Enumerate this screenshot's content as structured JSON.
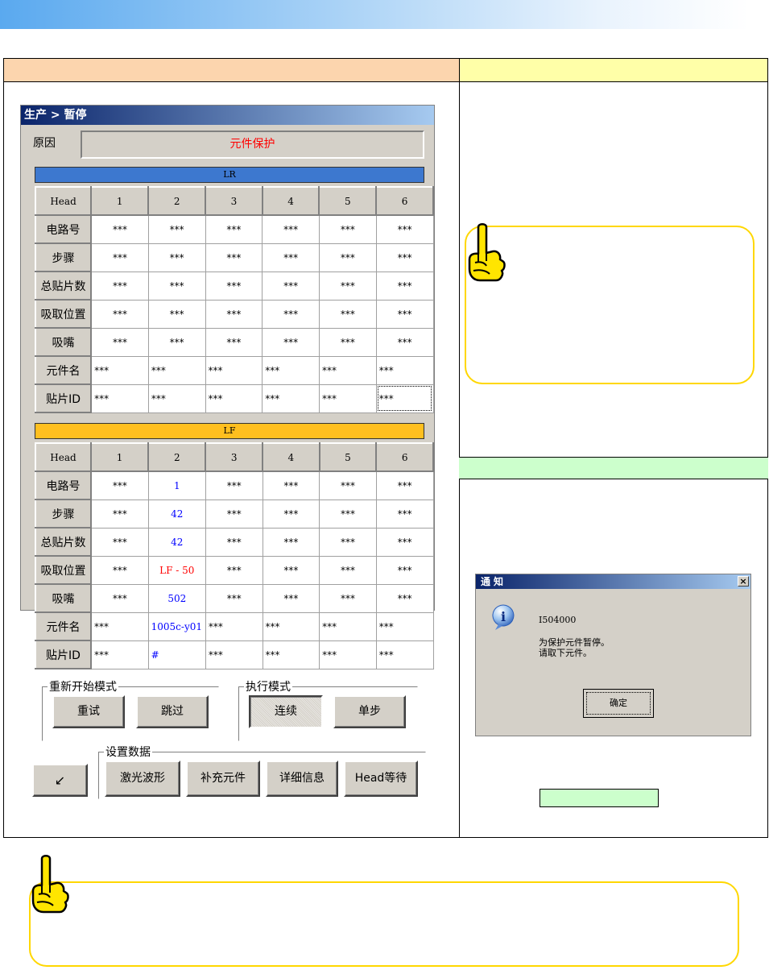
{
  "dialog": {
    "title": "生产 > 暂停",
    "reason_label": "原因",
    "reason_value": "元件保护",
    "lr_bar": "LR",
    "lf_bar": "LF",
    "head_label": "Head",
    "columns": [
      "1",
      "2",
      "3",
      "4",
      "5",
      "6"
    ],
    "row_labels": [
      "电路号",
      "步骤",
      "总贴片数",
      "吸取位置",
      "吸嘴",
      "元件名",
      "贴片ID"
    ],
    "lr_rows": [
      [
        "***",
        "***",
        "***",
        "***",
        "***",
        "***"
      ],
      [
        "***",
        "***",
        "***",
        "***",
        "***",
        "***"
      ],
      [
        "***",
        "***",
        "***",
        "***",
        "***",
        "***"
      ],
      [
        "***",
        "***",
        "***",
        "***",
        "***",
        "***"
      ],
      [
        "***",
        "***",
        "***",
        "***",
        "***",
        "***"
      ],
      [
        "***",
        "***",
        "***",
        "***",
        "***",
        "***"
      ],
      [
        "***",
        "***",
        "***",
        "***",
        "***",
        "***"
      ]
    ],
    "lf_rows": [
      [
        "***",
        "1",
        "***",
        "***",
        "***",
        "***"
      ],
      [
        "***",
        "42",
        "***",
        "***",
        "***",
        "***"
      ],
      [
        "***",
        "42",
        "***",
        "***",
        "***",
        "***"
      ],
      [
        "***",
        "LF - 50",
        "***",
        "***",
        "***",
        "***"
      ],
      [
        "***",
        "502",
        "***",
        "***",
        "***",
        "***"
      ],
      [
        "***",
        "1005c-y01",
        "***",
        "***",
        "***",
        "***"
      ],
      [
        "***",
        "#",
        "***",
        "***",
        "***",
        "***"
      ]
    ],
    "restart_group": "重新开始模式",
    "retry": "重试",
    "skip": "跳过",
    "exec_group": "执行模式",
    "continuous": "连续",
    "single_step": "单步",
    "settings_group": "设置数据",
    "laser": "激光波形",
    "supplement": "补充元件",
    "details": "详细信息",
    "head_wait": "Head等待",
    "minimize_icon": "↙"
  },
  "notice": {
    "title": "通知",
    "close": "×",
    "code": "I504000",
    "msg1": "为保护元件暂停。",
    "msg2": "请取下元件。",
    "ok": "确定"
  },
  "colors": {
    "lr_bar": "#3d78cf",
    "lf_bar": "#ffbf1f",
    "hdr_left": "#fcd5ae",
    "hdr_right": "#ffffa8",
    "hdr_green": "#ccffcc",
    "tip_border": "#ffd700"
  }
}
